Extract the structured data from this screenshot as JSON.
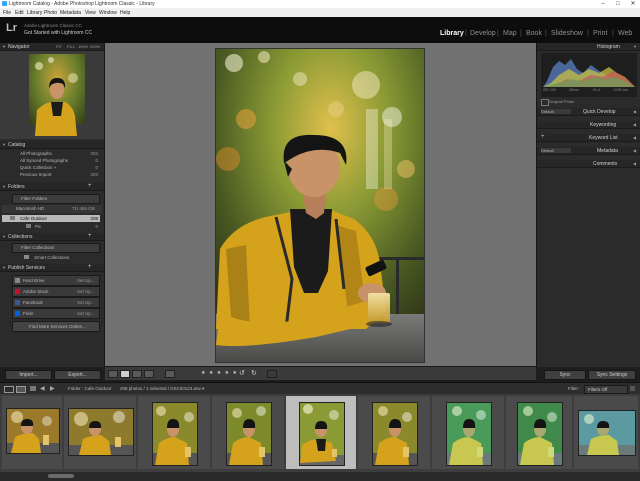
{
  "window": {
    "title": "Lightroom Catalog - Adobe Photoshop Lightroom Classic - Library",
    "controls": [
      "–",
      "□",
      "✕"
    ]
  },
  "menubar": [
    "File",
    "Edit",
    "Library",
    "Photo",
    "Metadata",
    "View",
    "Window",
    "Help"
  ],
  "identity": {
    "logo": "Lr",
    "plate_line1": "Adobe Lightroom Classic CC",
    "plate_line2": "Got Started with Lightroom CC"
  },
  "modules": [
    "Library",
    "Develop",
    "Map",
    "Book",
    "Slideshow",
    "Print",
    "Web"
  ],
  "active_module": "Library",
  "left_panel": {
    "navigator": {
      "title": "Navigator",
      "zoom": [
        "FIT",
        "FILL",
        "100%",
        "200%"
      ]
    },
    "catalog": {
      "title": "Catalog",
      "items": [
        {
          "label": "All Photographs",
          "count": "203"
        },
        {
          "label": "All Synced Photographs",
          "count": "0"
        },
        {
          "label": "Quick Collection +",
          "count": "0"
        },
        {
          "label": "Previous Import",
          "count": "203"
        }
      ]
    },
    "folders": {
      "title": "Folders",
      "filter": "Filter Folders",
      "volume": {
        "label": "Macintosh HD",
        "value": "71/ 465 GB"
      },
      "items": [
        {
          "label": "Cafe Outdoor",
          "count": "208"
        },
        {
          "label": "Pic",
          "count": "0"
        }
      ]
    },
    "collections": {
      "title": "Collections",
      "filter": "Filter Collections",
      "items": [
        {
          "label": "Smart Collections"
        }
      ]
    },
    "publish": {
      "title": "Publish Services",
      "items": [
        {
          "label": "Hard Drive",
          "action": "Set Up..."
        },
        {
          "label": "Adobe Stock",
          "action": "Set Up..."
        },
        {
          "label": "Facebook",
          "action": "Set Up..."
        },
        {
          "label": "Flickr",
          "action": "Set Up..."
        }
      ],
      "find_more": "Find More Services Online..."
    },
    "import_label": "Import...",
    "export_label": "Export..."
  },
  "right_panel": {
    "histogram": {
      "title": "Histogram",
      "info": [
        "ISO 100",
        "35mm",
        "f/1.4",
        "1/200 sec"
      ],
      "original_photo": "Original Photo"
    },
    "quick_develop": {
      "preset": "Default",
      "title": "Quick Develop"
    },
    "keywording": {
      "title": "Keywording"
    },
    "keyword_list": {
      "title": "Keyword List"
    },
    "metadata": {
      "preset": "Default",
      "title": "Metadata"
    },
    "comments": {
      "title": "Comments"
    },
    "sync_label": "Sync",
    "sync_settings_label": "Sync Settings"
  },
  "toolbar": {
    "stars": "★ ★ ★ ★ ★"
  },
  "filmstrip": {
    "pages": [
      "1",
      "2"
    ],
    "path": "Folder : Cafe Outdoor",
    "info": "208 photos / 1 selected / DSC00123.arw ▾",
    "filter_label": "Filter :",
    "filter_value": "Filters Off",
    "selected_index": 4
  },
  "colors": {
    "panel_bg": "#2b2b2b",
    "center_bg": "#717171",
    "shirt_yellow": "#d5a21c",
    "shirt_dark": "#1b1b1b",
    "skin": "#c9936a",
    "hair": "#141414",
    "bokeh_green": "#6e8b2c",
    "bokeh_orange": "#e6a33b"
  }
}
